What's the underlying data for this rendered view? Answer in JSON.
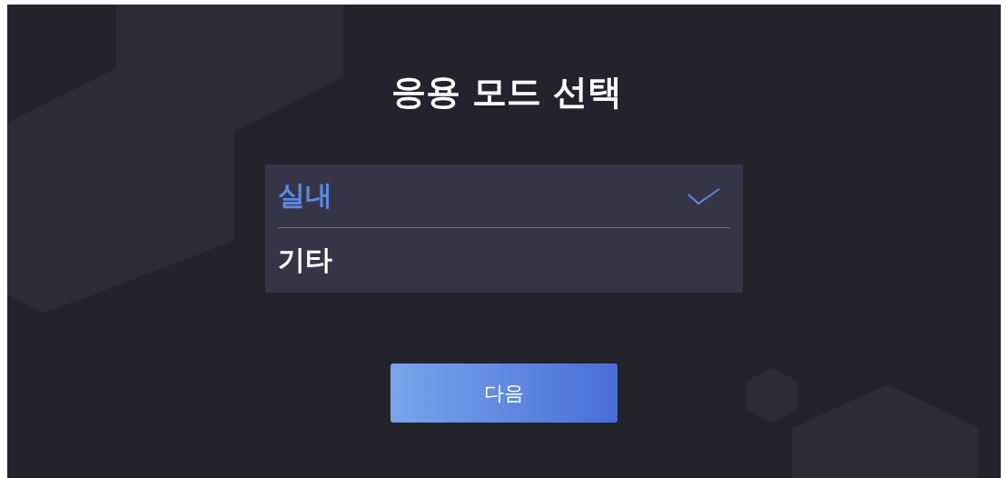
{
  "title": "응용 모드 선택",
  "options": [
    {
      "label": "실내",
      "selected": true
    },
    {
      "label": "기타",
      "selected": false
    }
  ],
  "button": "다음"
}
